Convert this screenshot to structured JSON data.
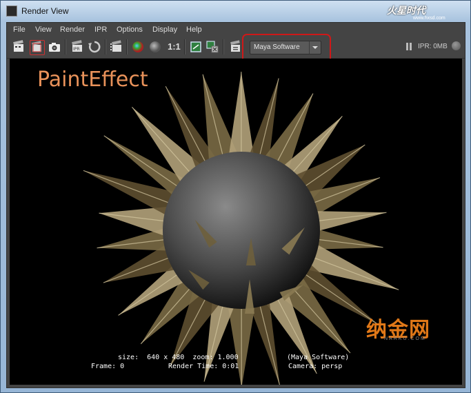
{
  "window": {
    "title": "Render View",
    "brand": "火星时代",
    "brand_url": "www.hxsd.com"
  },
  "menu": [
    "File",
    "View",
    "Render",
    "IPR",
    "Options",
    "Display",
    "Help"
  ],
  "toolbar": {
    "icons": [
      "redo-render-icon",
      "render-region-icon",
      "snapshot-icon",
      "ipr-render-icon",
      "refresh-ipr-icon",
      "render-sequence-icon",
      "rgb-channels-icon",
      "alpha-channel-icon",
      "zoom-1to1-icon",
      "keep-image-icon",
      "remove-image-icon",
      "render-settings-icon"
    ],
    "zoom_label": "1:1",
    "renderer": "Maya Software",
    "ipr_memory": "IPR: 0MB"
  },
  "render": {
    "overlay_title": "PaintEffect",
    "hud_size": "size:  640 x 480  zoom: 1.000",
    "hud_renderer": "(Maya Software)",
    "hud_frame": "Frame: 0",
    "hud_time": "Render Time: 0:01",
    "hud_camera": "Camera: persp"
  },
  "watermark": {
    "text": "纳金网",
    "sub": "NARKU.COM"
  },
  "colors": {
    "viewport_bg": "#000000",
    "title_orange": "#e9925a",
    "highlight_red": "#d01818",
    "spike_light": "#d8cba4",
    "spike_dark": "#5e4f30"
  }
}
